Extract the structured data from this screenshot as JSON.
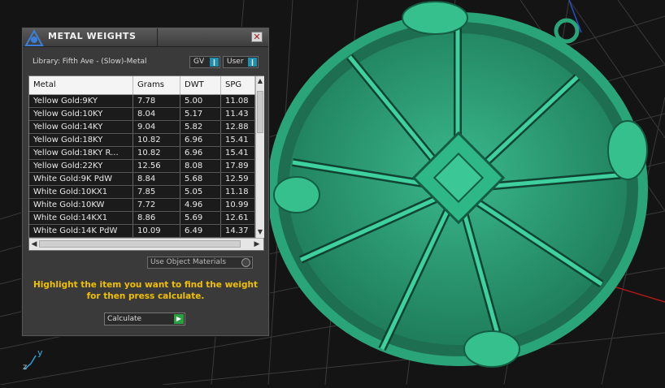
{
  "panel": {
    "title": "METAL WEIGHTS",
    "close_label": "✕",
    "library_label": "Library: Fifth Ave - (Slow)-Metal",
    "gv_label": "GV",
    "user_label": "User"
  },
  "table": {
    "headers": [
      "Metal",
      "Grams",
      "DWT",
      "SPG"
    ],
    "rows": [
      [
        "Yellow Gold:9KY",
        "7.78",
        "5.00",
        "11.08"
      ],
      [
        "Yellow Gold:10KY",
        "8.04",
        "5.17",
        "11.43"
      ],
      [
        "Yellow Gold:14KY",
        "9.04",
        "5.82",
        "12.88"
      ],
      [
        "Yellow Gold:18KY",
        "10.82",
        "6.96",
        "15.41"
      ],
      [
        "Yellow Gold:18KY R...",
        "10.82",
        "6.96",
        "15.41"
      ],
      [
        "Yellow Gold:22KY",
        "12.56",
        "8.08",
        "17.89"
      ],
      [
        "White Gold:9K PdW",
        "8.84",
        "5.68",
        "12.59"
      ],
      [
        "White Gold:10KX1",
        "7.85",
        "5.05",
        "11.18"
      ],
      [
        "White Gold:10KW",
        "7.72",
        "4.96",
        "10.99"
      ],
      [
        "White Gold:14KX1",
        "8.86",
        "5.69",
        "12.61"
      ],
      [
        "White Gold:14K PdW",
        "10.09",
        "6.49",
        "14.37"
      ]
    ]
  },
  "options": {
    "use_object_materials": "Use Object Materials"
  },
  "instruction": {
    "line1": "Highlight the item you want to find the weight",
    "line2": "for then press calculate."
  },
  "calculate_label": "Calculate",
  "viewport": {
    "axis_y": "y",
    "axis_z": "z"
  },
  "colors": {
    "pendant": "#2aa57a",
    "instruction": "#f0c000",
    "toggle_accent": "#1f8fb0"
  }
}
